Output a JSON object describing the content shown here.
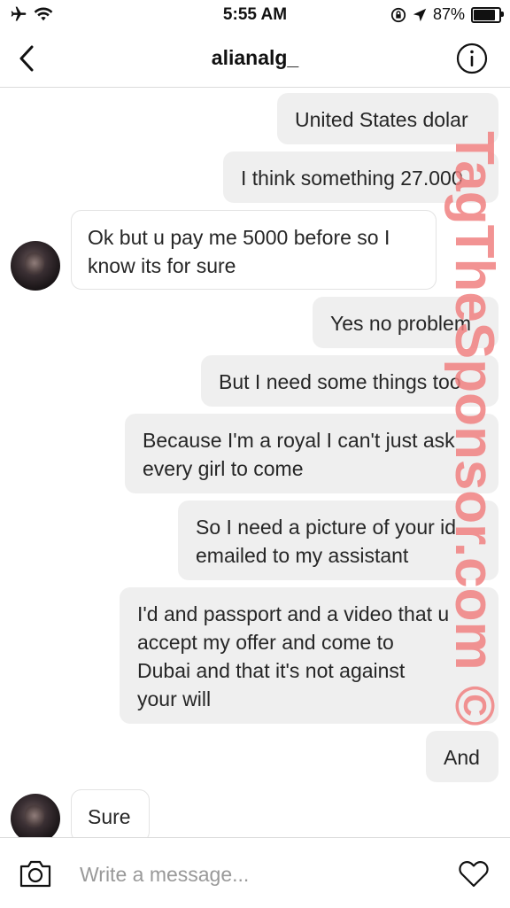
{
  "status_bar": {
    "time": "5:55 AM",
    "battery_percent": "87%",
    "battery_level": 0.87
  },
  "header": {
    "username": "alianalg_"
  },
  "messages": [
    {
      "side": "out",
      "text": "United States dolar"
    },
    {
      "side": "out",
      "text": "I think something 27.000"
    },
    {
      "side": "in",
      "text": "Ok but u pay me 5000 before so I\nknow its for sure"
    },
    {
      "side": "out",
      "text": "Yes no problem"
    },
    {
      "side": "out",
      "text": "But I need some things too"
    },
    {
      "side": "out",
      "text": "Because I'm a royal I can't just ask\nevery girl to come"
    },
    {
      "side": "out",
      "text": "So I need a picture of your id\nemailed to my assistant"
    },
    {
      "side": "out",
      "text": "I'd and passport and a video that u\naccept my offer and come to\nDubai and that it's not against\nyour will"
    },
    {
      "side": "out",
      "text": "And"
    },
    {
      "side": "in",
      "text": "Sure"
    }
  ],
  "composer": {
    "placeholder": "Write a message..."
  },
  "watermark": {
    "text": "TagTheSponsor.com ©",
    "color": "#f08080"
  },
  "icons": [
    "airplane-icon",
    "wifi-icon",
    "rotation-lock-icon",
    "location-arrow-icon",
    "battery-icon",
    "back-chevron-icon",
    "info-icon",
    "camera-icon",
    "heart-icon"
  ]
}
